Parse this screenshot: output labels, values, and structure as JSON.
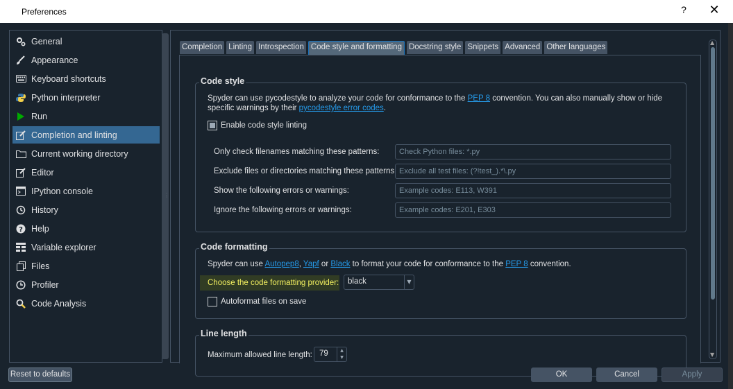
{
  "window": {
    "title": "Preferences",
    "help_label": "?",
    "close_label": "✕"
  },
  "sidebar": {
    "items": [
      {
        "label": "General",
        "icon": "gear-icon",
        "active": false
      },
      {
        "label": "Appearance",
        "icon": "paint-brush-icon",
        "active": false
      },
      {
        "label": "Keyboard shortcuts",
        "icon": "keyboard-icon",
        "active": false
      },
      {
        "label": "Python interpreter",
        "icon": "python-icon",
        "active": false
      },
      {
        "label": "Run",
        "icon": "play-icon",
        "active": false
      },
      {
        "label": "Completion and linting",
        "icon": "edit-icon",
        "active": true
      },
      {
        "label": "Current working directory",
        "icon": "folder-icon",
        "active": false
      },
      {
        "label": "Editor",
        "icon": "edit-icon",
        "active": false
      },
      {
        "label": "IPython console",
        "icon": "terminal-icon",
        "active": false
      },
      {
        "label": "History",
        "icon": "history-icon",
        "active": false
      },
      {
        "label": "Help",
        "icon": "help-icon",
        "active": false
      },
      {
        "label": "Variable explorer",
        "icon": "table-icon",
        "active": false
      },
      {
        "label": "Files",
        "icon": "files-icon",
        "active": false
      },
      {
        "label": "Profiler",
        "icon": "clock-icon",
        "active": false
      },
      {
        "label": "Code Analysis",
        "icon": "magnifier-icon",
        "active": false
      }
    ]
  },
  "tabs": [
    {
      "label": "Completion",
      "active": false
    },
    {
      "label": "Linting",
      "active": false
    },
    {
      "label": "Introspection",
      "active": false
    },
    {
      "label": "Code style and formatting",
      "active": true
    },
    {
      "label": "Docstring style",
      "active": false
    },
    {
      "label": "Snippets",
      "active": false
    },
    {
      "label": "Advanced",
      "active": false
    },
    {
      "label": "Other languages",
      "active": false
    }
  ],
  "code_style": {
    "title": "Code style",
    "desc_1": "Spyder can use pycodestyle to analyze your code for conformance to the ",
    "desc_link_pep8": "PEP 8",
    "desc_2": " convention. You can also manually show or hide specific warnings by their ",
    "desc_link_codes": "pycodestyle error codes",
    "desc_3": ".",
    "enable_label": "Enable code style linting",
    "enable_checked": true,
    "fields": [
      {
        "label": "Only check filenames matching these patterns:",
        "placeholder": "Check Python files: *.py"
      },
      {
        "label": "Exclude files or directories matching these patterns:",
        "placeholder": "Exclude all test files: (?!test_).*\\.py"
      },
      {
        "label": "Show the following errors or warnings:",
        "placeholder": "Example codes: E113, W391"
      },
      {
        "label": "Ignore the following errors or warnings:",
        "placeholder": "Example codes: E201, E303"
      }
    ]
  },
  "code_formatting": {
    "title": "Code formatting",
    "desc_1": "Spyder can use ",
    "link_autopep8": "Autopep8",
    "sep_1": ", ",
    "link_yapf": "Yapf",
    "sep_2": " or ",
    "link_black": "Black",
    "desc_2": " to format your code for conformance to the ",
    "link_pep8": "PEP 8",
    "desc_3": " convention.",
    "provider_label": "Choose the code formatting provider:",
    "provider_value": "black",
    "autoformat_label": "Autoformat files on save",
    "autoformat_checked": false
  },
  "line_length": {
    "title": "Line length",
    "max_label": "Maximum allowed line length:",
    "max_value": "79"
  },
  "buttons": {
    "reset": "Reset to defaults",
    "ok": "OK",
    "cancel": "Cancel",
    "apply": "Apply"
  }
}
